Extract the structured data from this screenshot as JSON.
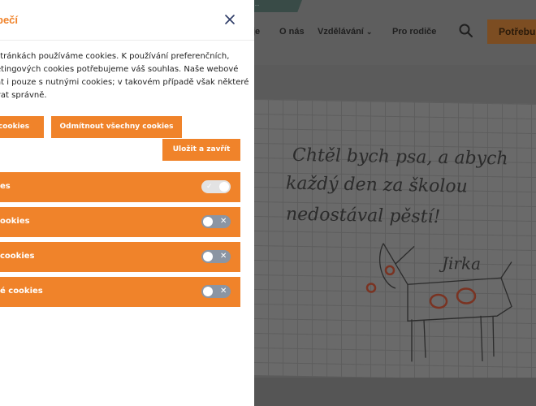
{
  "site": {
    "topstrip_text": "...",
    "nav": [
      {
        "label": "je"
      },
      {
        "label": "O nás"
      },
      {
        "label": "Vzdělávání",
        "has_dropdown": true
      },
      {
        "label": "Pro rodiče"
      }
    ],
    "cta_label": "Potřebu",
    "drawing_text": [
      "Chtěl bych psa, a abych",
      "každý den za školou",
      "nedostával pěstí!",
      "Jirka"
    ]
  },
  "cookie_panel": {
    "title": "pečí",
    "description": [
      "stránkách používáme cookies. K používání preferenčních,",
      "etingových cookies potřebujeme váš souhlas. Naše webové",
      "at i pouze s nutnými cookies; v takovém případě však některé",
      "vat správně."
    ],
    "buttons": {
      "accept": "cookies",
      "reject": "Odmítnout všechny cookies",
      "save": "Uložit a zavřít"
    },
    "categories": [
      {
        "label": "es",
        "enabled": true,
        "locked": true,
        "mark": "✓"
      },
      {
        "label": "ookies",
        "enabled": false,
        "mark": "✕"
      },
      {
        "label": "cookies",
        "enabled": false,
        "mark": "✕"
      },
      {
        "label": "é cookies",
        "enabled": false,
        "mark": "✕"
      }
    ]
  },
  "colors": {
    "accent": "#f0832a",
    "toggle_off": "#8b95a3",
    "toggle_on_locked": "#e3e3e3",
    "overlay": "#5b5b5b"
  }
}
